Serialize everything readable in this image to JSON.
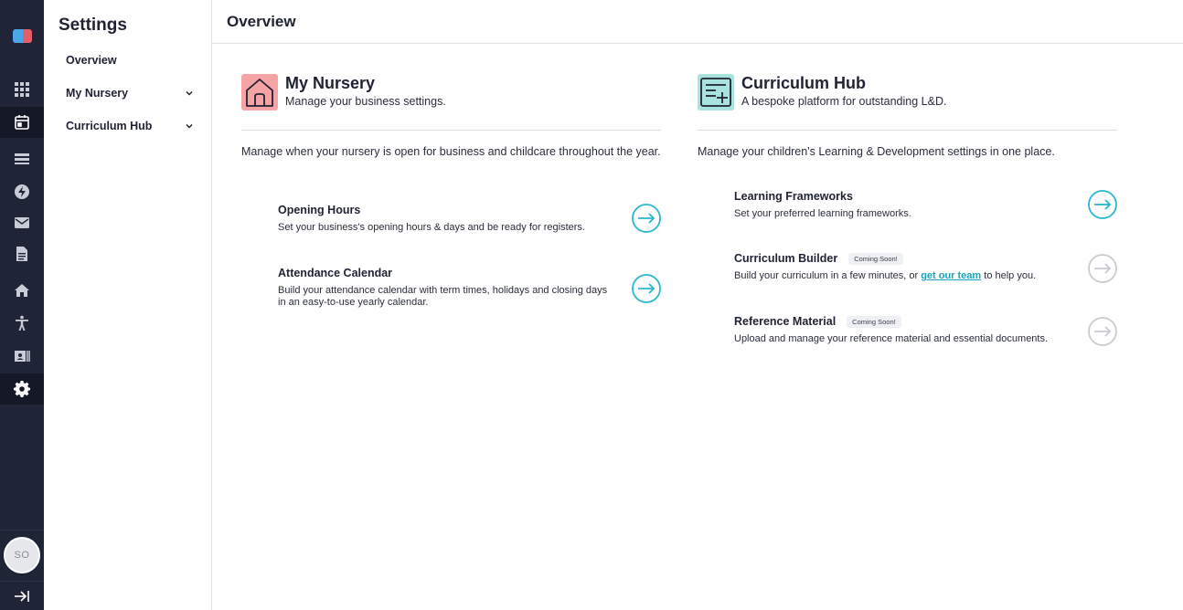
{
  "app": {
    "logo_colors": [
      "#4aa6e8",
      "#e35d6a"
    ],
    "accent": "#27b8cf",
    "disabled_arrow": "#c9cbd1",
    "rail_bg": "#1f2436"
  },
  "rail": {
    "items": [
      "dashboard-grid-icon",
      "calendar-icon",
      "register-list-icon",
      "bolt-icon",
      "mail-icon",
      "document-icon",
      "home-icon",
      "accessibility-icon",
      "id-card-icon",
      "settings-gear-icon"
    ],
    "active": "settings-gear-icon",
    "avatar_initials": "SO",
    "collapse_icon": "collapse-arrow-icon"
  },
  "sidebar": {
    "title": "Settings",
    "items": [
      {
        "label": "Overview",
        "has_chevron": false
      },
      {
        "label": "My Nursery",
        "has_chevron": true
      },
      {
        "label": "Curriculum Hub",
        "has_chevron": true
      }
    ]
  },
  "page": {
    "title": "Overview"
  },
  "nursery": {
    "icon": "house-icon",
    "icon_bg": "#f6a3a6",
    "title": "My Nursery",
    "subtitle": "Manage your business settings.",
    "description": "Manage when your nursery is open for business and childcare throughout the year.",
    "rows": [
      {
        "title": "Opening Hours",
        "text": "Set your business's opening hours & days and be ready for registers."
      },
      {
        "title": "Attendance Calendar",
        "text": "Build your attendance calendar with term times, holidays and closing days in an easy-to-use yearly calendar."
      }
    ]
  },
  "curriculum": {
    "icon": "board-plus-icon",
    "icon_bg": "#a8e4de",
    "title": "Curriculum Hub",
    "subtitle": "A bespoke platform for outstanding L&D.",
    "description": "Manage your children's Learning & Development settings in one place.",
    "rows": [
      {
        "title": "Learning Frameworks",
        "text": "Set your preferred learning frameworks."
      },
      {
        "title": "Curriculum Builder",
        "badge": "Coming Soon!",
        "text_before": "Build your curriculum in a few minutes, or ",
        "link": "get our team",
        "text_after": " to help you."
      },
      {
        "title": "Reference Material",
        "badge": "Coming Soon!",
        "text": "Upload and manage your reference material and essential documents."
      }
    ]
  }
}
